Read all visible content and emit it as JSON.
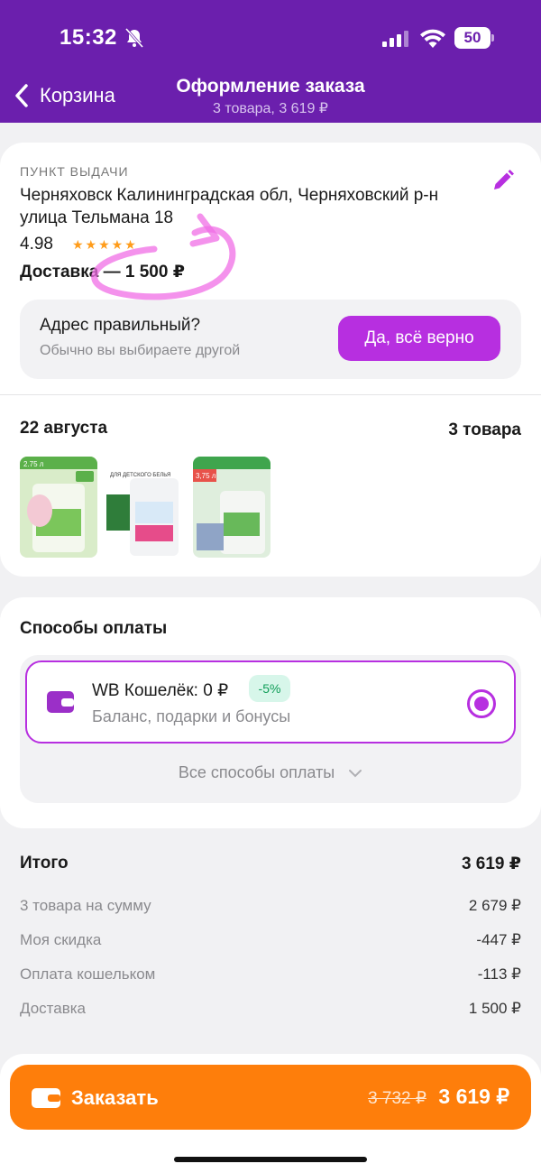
{
  "status_bar": {
    "time": "15:32",
    "battery": "50"
  },
  "header": {
    "back_label": "Корзина",
    "title": "Оформление заказа",
    "subtitle": "3 товара, 3 619 ₽"
  },
  "pickup": {
    "section_label": "ПУНКТ ВЫДАЧИ",
    "address": "Черняховск Калининградская обл, Черняховский р-н улица Тельмана 18",
    "rating": "4.98",
    "stars": "★★★★★",
    "delivery": "Доставка — 1 500 ₽",
    "confirm_question": "Адрес правильный?",
    "confirm_hint": "Обычно вы выбираете другой",
    "confirm_button": "Да, всё верно"
  },
  "shipment": {
    "date": "22 августа",
    "items_count": "3 товара",
    "products": [
      {
        "tag": "2.75 л"
      },
      {
        "tag": "ДЛЯ ДЕТСКОГО БЕЛЬЯ"
      },
      {
        "tag": "3,75 л"
      }
    ]
  },
  "payment": {
    "title": "Способы оплаты",
    "option_name": "WB Кошелёк: 0 ₽",
    "option_badge": "-5%",
    "option_desc": "Баланс, подарки и бонусы",
    "all_methods": "Все способы оплаты"
  },
  "summary": {
    "total_label": "Итого",
    "total_value": "3 619 ₽",
    "rows": [
      {
        "label": "3 товара на сумму",
        "value": "2 679 ₽"
      },
      {
        "label": "Моя скидка",
        "value": "-447 ₽"
      },
      {
        "label": "Оплата кошельком",
        "value": "-113 ₽"
      },
      {
        "label": "Доставка",
        "value": "1 500 ₽"
      }
    ]
  },
  "order_button": {
    "label": "Заказать",
    "old_price": "3 732 ₽",
    "price": "3 619 ₽"
  },
  "colors": {
    "header": "#6b1fad",
    "accent": "#b72fe0",
    "order": "#fe7e0b",
    "discount": "#0f9d58"
  }
}
